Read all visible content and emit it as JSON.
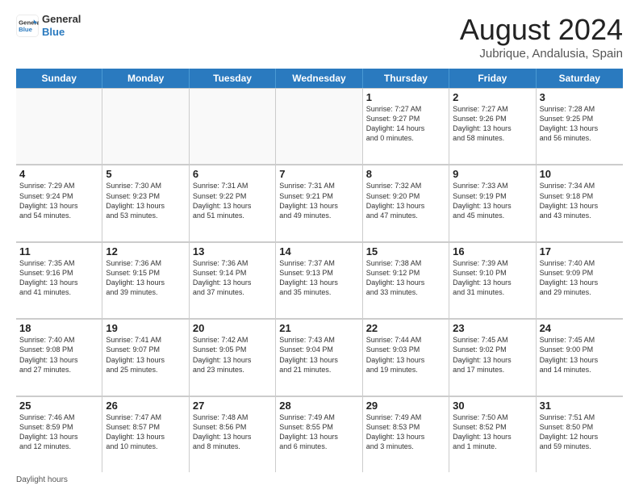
{
  "logo": {
    "line1": "General",
    "line2": "Blue"
  },
  "title": "August 2024",
  "subtitle": "Jubrique, Andalusia, Spain",
  "days": [
    "Sunday",
    "Monday",
    "Tuesday",
    "Wednesday",
    "Thursday",
    "Friday",
    "Saturday"
  ],
  "footer": "Daylight hours",
  "rows": [
    [
      {
        "day": "",
        "text": "",
        "empty": true
      },
      {
        "day": "",
        "text": "",
        "empty": true
      },
      {
        "day": "",
        "text": "",
        "empty": true
      },
      {
        "day": "",
        "text": "",
        "empty": true
      },
      {
        "day": "1",
        "text": "Sunrise: 7:27 AM\nSunset: 9:27 PM\nDaylight: 14 hours\nand 0 minutes.",
        "empty": false
      },
      {
        "day": "2",
        "text": "Sunrise: 7:27 AM\nSunset: 9:26 PM\nDaylight: 13 hours\nand 58 minutes.",
        "empty": false
      },
      {
        "day": "3",
        "text": "Sunrise: 7:28 AM\nSunset: 9:25 PM\nDaylight: 13 hours\nand 56 minutes.",
        "empty": false
      }
    ],
    [
      {
        "day": "4",
        "text": "Sunrise: 7:29 AM\nSunset: 9:24 PM\nDaylight: 13 hours\nand 54 minutes.",
        "empty": false
      },
      {
        "day": "5",
        "text": "Sunrise: 7:30 AM\nSunset: 9:23 PM\nDaylight: 13 hours\nand 53 minutes.",
        "empty": false
      },
      {
        "day": "6",
        "text": "Sunrise: 7:31 AM\nSunset: 9:22 PM\nDaylight: 13 hours\nand 51 minutes.",
        "empty": false
      },
      {
        "day": "7",
        "text": "Sunrise: 7:31 AM\nSunset: 9:21 PM\nDaylight: 13 hours\nand 49 minutes.",
        "empty": false
      },
      {
        "day": "8",
        "text": "Sunrise: 7:32 AM\nSunset: 9:20 PM\nDaylight: 13 hours\nand 47 minutes.",
        "empty": false
      },
      {
        "day": "9",
        "text": "Sunrise: 7:33 AM\nSunset: 9:19 PM\nDaylight: 13 hours\nand 45 minutes.",
        "empty": false
      },
      {
        "day": "10",
        "text": "Sunrise: 7:34 AM\nSunset: 9:18 PM\nDaylight: 13 hours\nand 43 minutes.",
        "empty": false
      }
    ],
    [
      {
        "day": "11",
        "text": "Sunrise: 7:35 AM\nSunset: 9:16 PM\nDaylight: 13 hours\nand 41 minutes.",
        "empty": false
      },
      {
        "day": "12",
        "text": "Sunrise: 7:36 AM\nSunset: 9:15 PM\nDaylight: 13 hours\nand 39 minutes.",
        "empty": false
      },
      {
        "day": "13",
        "text": "Sunrise: 7:36 AM\nSunset: 9:14 PM\nDaylight: 13 hours\nand 37 minutes.",
        "empty": false
      },
      {
        "day": "14",
        "text": "Sunrise: 7:37 AM\nSunset: 9:13 PM\nDaylight: 13 hours\nand 35 minutes.",
        "empty": false
      },
      {
        "day": "15",
        "text": "Sunrise: 7:38 AM\nSunset: 9:12 PM\nDaylight: 13 hours\nand 33 minutes.",
        "empty": false
      },
      {
        "day": "16",
        "text": "Sunrise: 7:39 AM\nSunset: 9:10 PM\nDaylight: 13 hours\nand 31 minutes.",
        "empty": false
      },
      {
        "day": "17",
        "text": "Sunrise: 7:40 AM\nSunset: 9:09 PM\nDaylight: 13 hours\nand 29 minutes.",
        "empty": false
      }
    ],
    [
      {
        "day": "18",
        "text": "Sunrise: 7:40 AM\nSunset: 9:08 PM\nDaylight: 13 hours\nand 27 minutes.",
        "empty": false
      },
      {
        "day": "19",
        "text": "Sunrise: 7:41 AM\nSunset: 9:07 PM\nDaylight: 13 hours\nand 25 minutes.",
        "empty": false
      },
      {
        "day": "20",
        "text": "Sunrise: 7:42 AM\nSunset: 9:05 PM\nDaylight: 13 hours\nand 23 minutes.",
        "empty": false
      },
      {
        "day": "21",
        "text": "Sunrise: 7:43 AM\nSunset: 9:04 PM\nDaylight: 13 hours\nand 21 minutes.",
        "empty": false
      },
      {
        "day": "22",
        "text": "Sunrise: 7:44 AM\nSunset: 9:03 PM\nDaylight: 13 hours\nand 19 minutes.",
        "empty": false
      },
      {
        "day": "23",
        "text": "Sunrise: 7:45 AM\nSunset: 9:02 PM\nDaylight: 13 hours\nand 17 minutes.",
        "empty": false
      },
      {
        "day": "24",
        "text": "Sunrise: 7:45 AM\nSunset: 9:00 PM\nDaylight: 13 hours\nand 14 minutes.",
        "empty": false
      }
    ],
    [
      {
        "day": "25",
        "text": "Sunrise: 7:46 AM\nSunset: 8:59 PM\nDaylight: 13 hours\nand 12 minutes.",
        "empty": false
      },
      {
        "day": "26",
        "text": "Sunrise: 7:47 AM\nSunset: 8:57 PM\nDaylight: 13 hours\nand 10 minutes.",
        "empty": false
      },
      {
        "day": "27",
        "text": "Sunrise: 7:48 AM\nSunset: 8:56 PM\nDaylight: 13 hours\nand 8 minutes.",
        "empty": false
      },
      {
        "day": "28",
        "text": "Sunrise: 7:49 AM\nSunset: 8:55 PM\nDaylight: 13 hours\nand 6 minutes.",
        "empty": false
      },
      {
        "day": "29",
        "text": "Sunrise: 7:49 AM\nSunset: 8:53 PM\nDaylight: 13 hours\nand 3 minutes.",
        "empty": false
      },
      {
        "day": "30",
        "text": "Sunrise: 7:50 AM\nSunset: 8:52 PM\nDaylight: 13 hours\nand 1 minute.",
        "empty": false
      },
      {
        "day": "31",
        "text": "Sunrise: 7:51 AM\nSunset: 8:50 PM\nDaylight: 12 hours\nand 59 minutes.",
        "empty": false
      }
    ]
  ]
}
